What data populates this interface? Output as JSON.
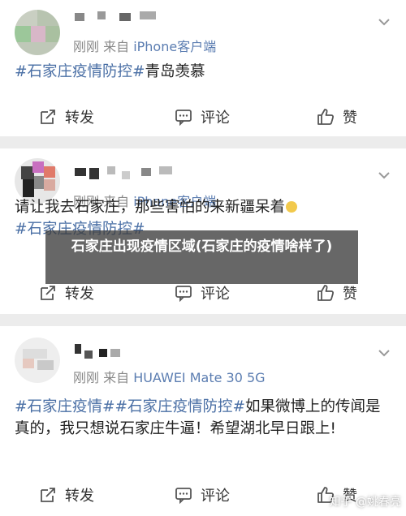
{
  "posts": [
    {
      "meta_prefix": "刚刚  来自 ",
      "source": "iPhone客户端",
      "tag1": "#石家庄疫情防控#",
      "text1": "青岛羡慕",
      "actions": {
        "share": "转发",
        "comment": "评论",
        "like": "赞"
      }
    },
    {
      "meta_prefix": "刚刚  来自 ",
      "source": "iPhone客户端",
      "line1": "请让我去石家庄，那些害怕的来新疆呆着",
      "tag1": "#石家庄疫情防控#",
      "actions": {
        "share": "转发",
        "comment": "评论",
        "like": "赞"
      }
    },
    {
      "meta_prefix": "刚刚  来自 ",
      "source": "HUAWEI Mate 30 5G",
      "tag1": "#石家庄疫情#",
      "tag2": "#石家庄疫情防控#",
      "text1": "如果微博上的传闻是真的，我只想说石家庄牛逼！希望湖北早日跟上!",
      "actions": {
        "share": "转发",
        "comment": "评论",
        "like": "赞"
      }
    }
  ],
  "overlay": {
    "title": "石家庄出现疫情区域(石家庄的疫情啥样了)"
  },
  "watermark": "知乎 @姚春亮",
  "colors": {
    "link": "#4a6fa5",
    "meta": "#888888",
    "background": "#ececec"
  }
}
